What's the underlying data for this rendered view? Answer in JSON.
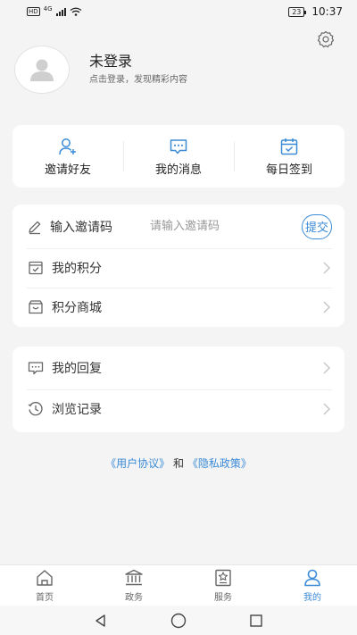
{
  "status_bar": {
    "hd": "HD",
    "network": "4G",
    "battery": "23",
    "time": "10:37"
  },
  "profile": {
    "title": "未登录",
    "subtitle": "点击登录，发现精彩内容"
  },
  "quick_actions": [
    {
      "label": "邀请好友",
      "icon": "add-user-icon"
    },
    {
      "label": "我的消息",
      "icon": "message-icon"
    },
    {
      "label": "每日签到",
      "icon": "calendar-check-icon"
    }
  ],
  "invite": {
    "label": "输入邀请码",
    "placeholder": "请输入邀请码",
    "button": "提交"
  },
  "menu1": [
    {
      "label": "我的积分",
      "icon": "points-icon"
    },
    {
      "label": "积分商城",
      "icon": "store-icon"
    }
  ],
  "menu2": [
    {
      "label": "我的回复",
      "icon": "reply-icon"
    },
    {
      "label": "浏览记录",
      "icon": "history-icon"
    }
  ],
  "agreement": {
    "user_link": "《用户协议》",
    "and": "和",
    "privacy_link": "《隐私政策》"
  },
  "tabbar": [
    {
      "label": "首页",
      "icon": "home-icon",
      "active": false
    },
    {
      "label": "政务",
      "icon": "government-icon",
      "active": false
    },
    {
      "label": "服务",
      "icon": "service-icon",
      "active": false
    },
    {
      "label": "我的",
      "icon": "user-icon",
      "active": true
    }
  ],
  "colors": {
    "accent": "#3b8bd6",
    "background": "#f4f4f5",
    "card": "#ffffff"
  }
}
